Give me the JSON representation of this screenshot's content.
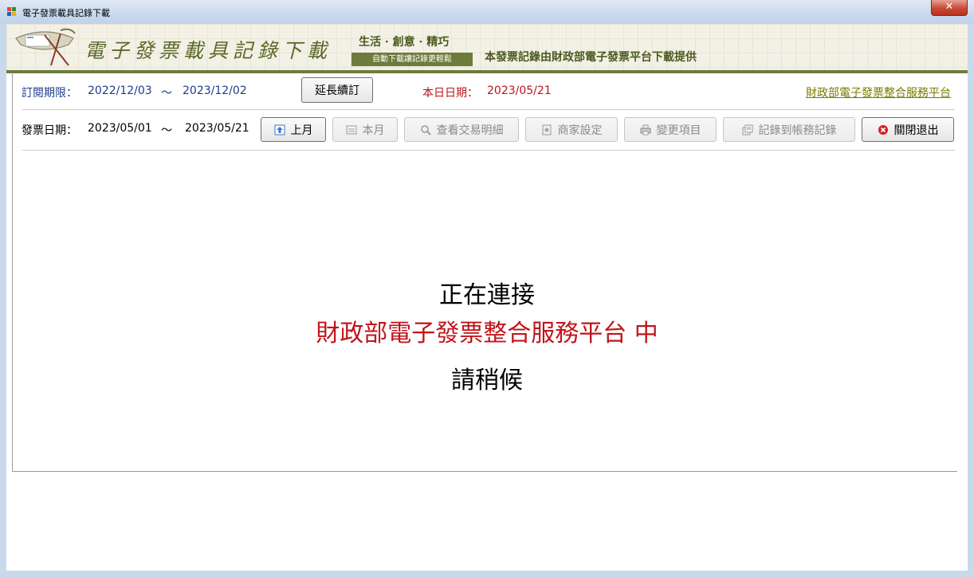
{
  "window": {
    "title": "電子發票載具記錄下載",
    "close_label": "✕"
  },
  "banner": {
    "title": "電子發票載具記錄下載",
    "slogan": "生活 · 創意 · 精巧",
    "tag": "自動下載讓記錄更輕鬆",
    "provider": "本發票記錄由財政部電子發票平台下載提供"
  },
  "subscription": {
    "label": "訂閱期限：",
    "start": "2022/12/03",
    "tilde": "～",
    "end": "2023/12/02",
    "extend_button": "延長續訂",
    "today_label": "本日日期：",
    "today": "2023/05/21",
    "platform_link": "財政部電子發票整合服務平台"
  },
  "invoice_range": {
    "label": "發票日期：",
    "start": "2023/05/01",
    "tilde": "～",
    "end": "2023/05/21"
  },
  "toolbar": {
    "prev_month": "上月",
    "this_month": "本月",
    "view_details": "查看交易明細",
    "merchant_settings": "商家設定",
    "change_items": "變更項目",
    "record_to_ledger": "記錄到帳務記錄",
    "close_exit": "關閉退出"
  },
  "status": {
    "line1": "正在連接",
    "line2": "財政部電子發票整合服務平台 中",
    "line3": "請稍候"
  },
  "colors": {
    "accent_green": "#6d7b3c",
    "blue_text": "#1e3c8a",
    "red_text": "#b8161b",
    "link_olive": "#7a7a00"
  }
}
